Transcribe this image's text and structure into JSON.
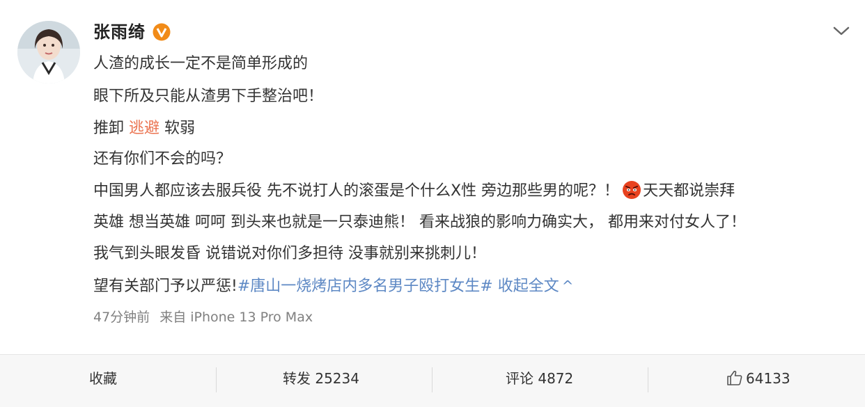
{
  "post": {
    "username": "张雨绮",
    "lines": {
      "l1": "人渣的成长一定不是简单形成的",
      "l2": "眼下所及只能从渣男下手整治吧！",
      "l3_a": "推卸 ",
      "l3_link": "逃避",
      "l3_b": " 软弱",
      "l4": "还有你们不会的吗？",
      "l5": "中国男人都应该去服兵役 先不说打人的滚蛋是个什么X性 旁边那些男的呢？！",
      "l5_b": "天天都说崇拜",
      "l6": "英雄 想当英雄 呵呵 到头来也就是一只泰迪熊！ 看来战狼的影响力确实大， 都用来对付女人了！",
      "l7": "我气到头眼发昏 说错说对你们多担待 没事就别来挑刺儿！",
      "l8": "望有关部门予以严惩!",
      "topic": "#唐山一烧烤店内多名男子殴打女生#",
      "collapse": " 收起全文",
      "collapse_arrow": "^"
    },
    "time": "47分钟前",
    "source": "来自 iPhone 13 Pro Max"
  },
  "actions": {
    "favorite": "收藏",
    "repost": "转发 25234",
    "comment": "评论 4872",
    "like": "64133"
  },
  "icons": {
    "verified": "verified-badge-icon",
    "chevron": "chevron-down-icon",
    "emoji": "angry-face-emoji-icon",
    "like": "thumbs-up-icon"
  },
  "colors": {
    "verified": "#f18b18",
    "topic": "#5d88c4",
    "highlight": "#eb7350"
  }
}
